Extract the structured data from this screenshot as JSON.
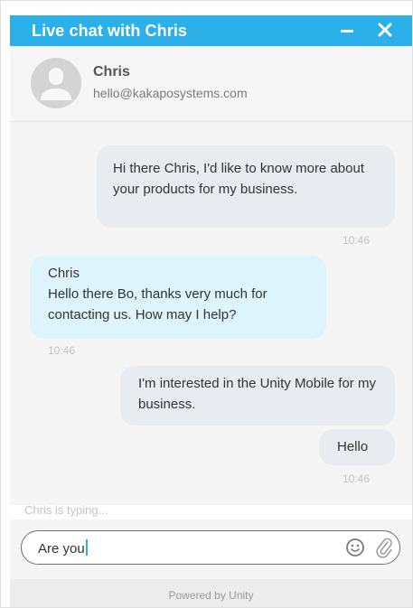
{
  "window": {
    "title": "Live chat with Chris",
    "accent_color": "#2cb0ea"
  },
  "agent": {
    "name": "Chris",
    "email": "hello@kakaposystems.com",
    "avatar_icon": "user-avatar-icon"
  },
  "messages": [
    {
      "direction": "outgoing",
      "text": "Hi there Chris, I'd like to know more about your products for my business.",
      "time": "10:46"
    },
    {
      "direction": "incoming",
      "sender": "Chris",
      "text": "Hello there Bo, thanks very much for contacting us. How may I help?",
      "time": "10:46"
    },
    {
      "direction": "outgoing",
      "text": "I'm interested in the Unity Mobile for my business."
    },
    {
      "direction": "outgoing",
      "text": "Hello",
      "time": "10:46"
    }
  ],
  "status": {
    "typing": "Chris is typing..."
  },
  "composer": {
    "value": "Are you",
    "emoji_icon": "emoji-icon",
    "attach_icon": "paperclip-icon"
  },
  "footer": {
    "powered_by": "Powered by Unity"
  }
}
